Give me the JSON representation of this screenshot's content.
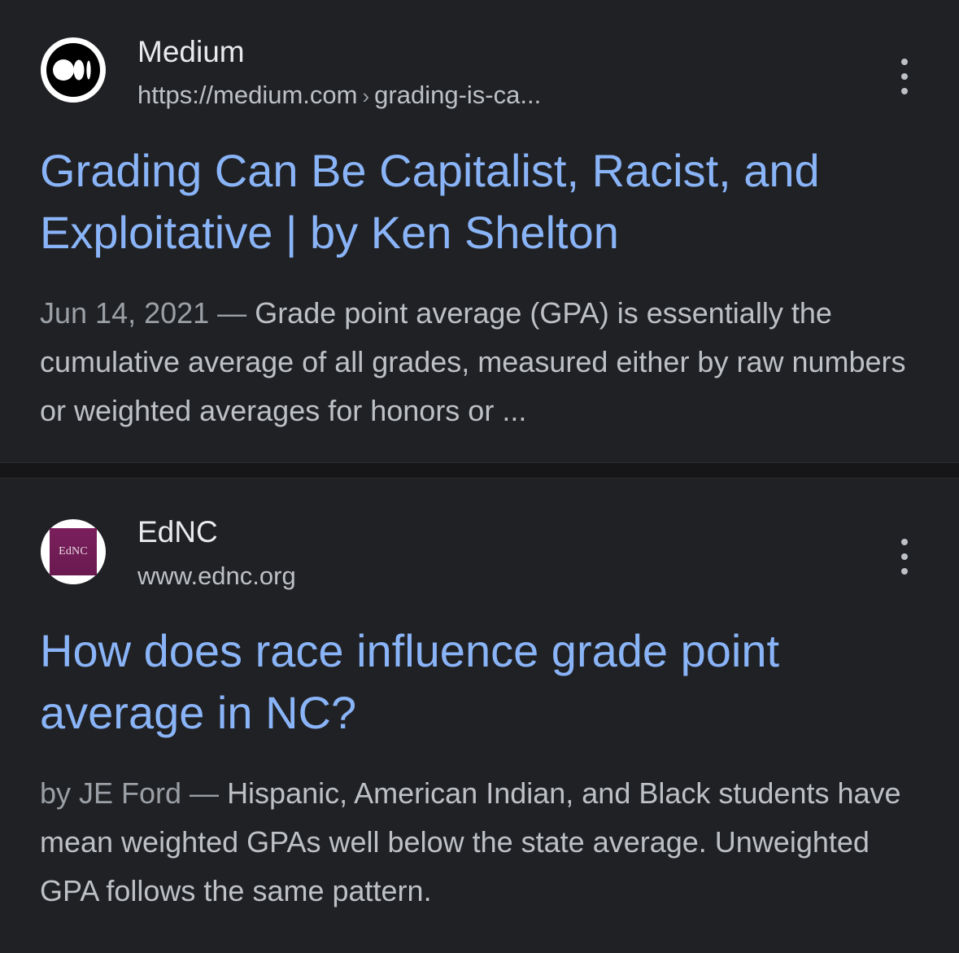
{
  "results": [
    {
      "site_name": "Medium",
      "url_base": "https://medium.com",
      "url_sep": "›",
      "url_path": "grading-is-ca...",
      "favicon_icon": "medium-logo-icon",
      "title": "Grading Can Be Capitalist, Racist, and Exploitative | by Ken Shelton",
      "snippet_meta": "Jun 14, 2021 — ",
      "snippet_text": "Grade point average (GPA) is essentially the cumulative average of all grades, measured either by raw numbers or weighted averages for honors or ..."
    },
    {
      "site_name": "EdNC",
      "url_base": "www.ednc.org",
      "favicon_icon": "ednc-logo-icon",
      "favicon_text": "EdNC",
      "title": "How does race influence grade point average in NC?",
      "snippet_meta": "by JE Ford — ",
      "snippet_text": "Hispanic, American Indian, and Black students have mean weighted GPAs well below the state average. Unweighted GPA follows the same pattern."
    }
  ],
  "colors": {
    "background": "#202124",
    "title_link": "#8ab4f8",
    "text": "#bdc1c6",
    "meta": "#9aa0a6",
    "site_name": "#e8eaed"
  }
}
